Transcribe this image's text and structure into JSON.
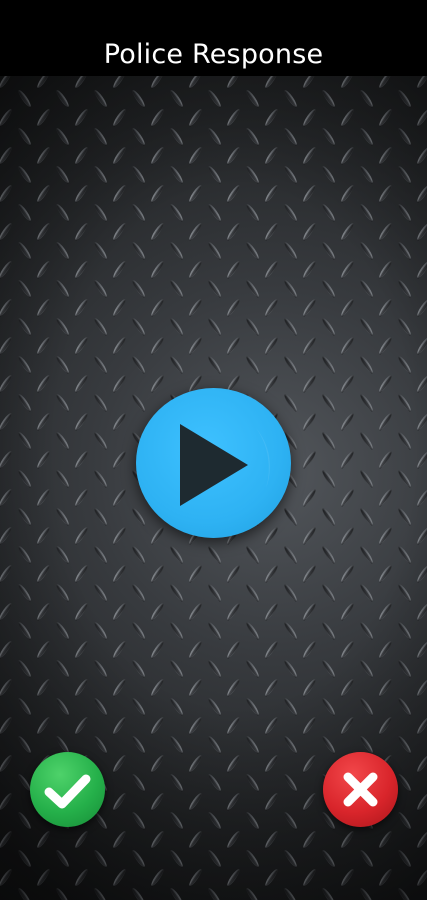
{
  "header": {
    "title": "Police Response"
  },
  "controls": {
    "play": {
      "icon": "play-icon",
      "color": "#2eb2f3"
    },
    "accept": {
      "icon": "checkmark-icon",
      "color": "#25b04a"
    },
    "decline": {
      "icon": "x-icon",
      "color": "#d9252b"
    }
  },
  "background": {
    "texture": "diamond-plate-steel",
    "base_color": "#2a2c2f"
  }
}
